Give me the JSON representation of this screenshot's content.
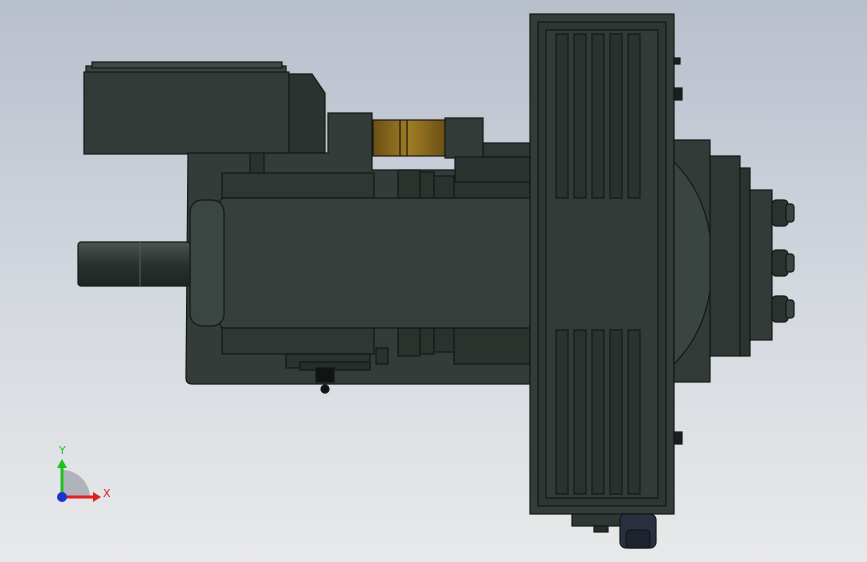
{
  "colors": {
    "background_top": "#b8bfcc",
    "background_bottom": "#e8e9ea",
    "body_dark": "#2f3733",
    "body_mid": "#3a4440",
    "edge": "#141816",
    "bronze": "#8a6a1e",
    "axis_x": "#e02020",
    "axis_y": "#20c020",
    "axis_origin": "#2030d0"
  },
  "triad": {
    "x_label": "X",
    "y_label": "Y"
  }
}
